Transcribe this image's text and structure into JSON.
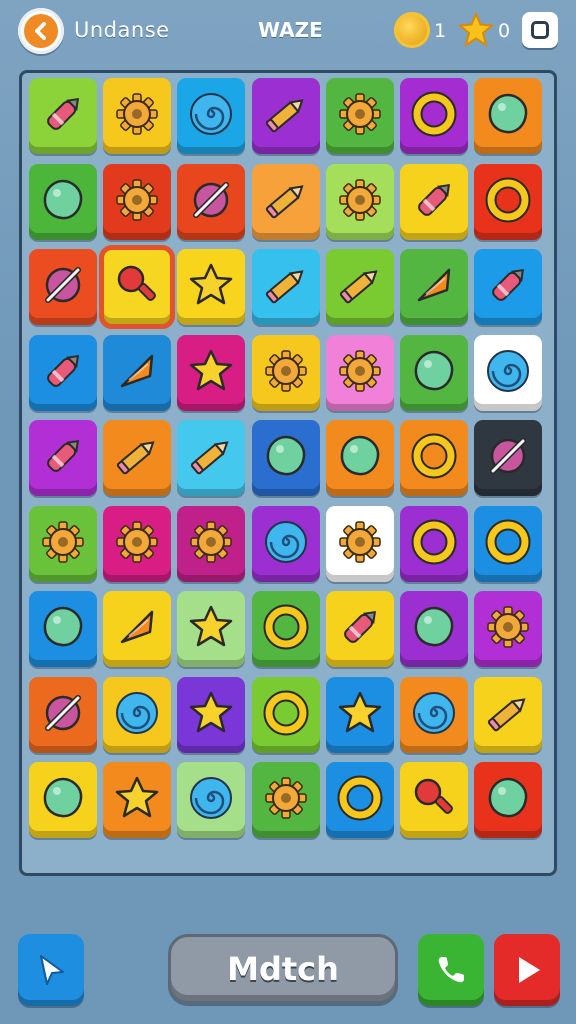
{
  "header": {
    "app_title": "Undanse",
    "level_title": "WAZE",
    "coins": "1",
    "stars": "0"
  },
  "board": {
    "rows": 9,
    "cols": 7,
    "selected": [
      2,
      1
    ],
    "tiles": [
      [
        {
          "color": "#8cd33a",
          "icon": "crayon-icon"
        },
        {
          "color": "#f6c71c",
          "icon": "gear-icon"
        },
        {
          "color": "#1ba6e8",
          "icon": "spiral-icon"
        },
        {
          "color": "#9b2fd1",
          "icon": "pencil-icon"
        },
        {
          "color": "#52b640",
          "icon": "gear-icon"
        },
        {
          "color": "#a52cd0",
          "icon": "ring-icon"
        },
        {
          "color": "#f28a1d",
          "icon": "blob-icon"
        }
      ],
      [
        {
          "color": "#4cb63a",
          "icon": "blob-icon"
        },
        {
          "color": "#e23a1d",
          "icon": "gear-icon"
        },
        {
          "color": "#e8461c",
          "icon": "crossed-icon"
        },
        {
          "color": "#f6a13a",
          "icon": "pencil-icon"
        },
        {
          "color": "#a5df5a",
          "icon": "gear-icon"
        },
        {
          "color": "#f6d21c",
          "icon": "crayon-icon"
        },
        {
          "color": "#e8321c",
          "icon": "ring-icon"
        }
      ],
      [
        {
          "color": "#ec4d20",
          "icon": "crossed-icon"
        },
        {
          "color": "#f6d620",
          "icon": "pin-icon"
        },
        {
          "color": "#f8d41c",
          "icon": "star-icon"
        },
        {
          "color": "#35c0ee",
          "icon": "pencil-icon"
        },
        {
          "color": "#7acb32",
          "icon": "pencil-icon"
        },
        {
          "color": "#52b640",
          "icon": "cone-icon"
        },
        {
          "color": "#1c9be8",
          "icon": "crayon-icon"
        }
      ],
      [
        {
          "color": "#1c8fe2",
          "icon": "crayon-icon"
        },
        {
          "color": "#1e8ad8",
          "icon": "cone-icon"
        },
        {
          "color": "#d81e84",
          "icon": "star-icon"
        },
        {
          "color": "#f6c71c",
          "icon": "gear-icon"
        },
        {
          "color": "#f080d8",
          "icon": "gear-icon"
        },
        {
          "color": "#52b640",
          "icon": "blob-icon"
        },
        {
          "color": "#ffffff",
          "icon": "spiral-icon"
        }
      ],
      [
        {
          "color": "#b22fd6",
          "icon": "crayon-icon"
        },
        {
          "color": "#f28a1d",
          "icon": "pencil-icon"
        },
        {
          "color": "#45c8ee",
          "icon": "pencil-icon"
        },
        {
          "color": "#2a6fcf",
          "icon": "blob-icon"
        },
        {
          "color": "#f28a1d",
          "icon": "blob-icon"
        },
        {
          "color": "#f28a1d",
          "icon": "ring-icon"
        },
        {
          "color": "#2f3740",
          "icon": "crossed-icon"
        }
      ],
      [
        {
          "color": "#6ac23a",
          "icon": "gear-icon"
        },
        {
          "color": "#d81e84",
          "icon": "gear-icon"
        },
        {
          "color": "#c0208a",
          "icon": "gear-icon"
        },
        {
          "color": "#9b2fd1",
          "icon": "spiral-icon"
        },
        {
          "color": "#ffffff",
          "icon": "gear-icon"
        },
        {
          "color": "#9b2fd1",
          "icon": "ring-icon"
        },
        {
          "color": "#1c8fe2",
          "icon": "ring-icon"
        }
      ],
      [
        {
          "color": "#1c8fe2",
          "icon": "blob-icon"
        },
        {
          "color": "#f6d21c",
          "icon": "cone-icon"
        },
        {
          "color": "#a5df8a",
          "icon": "star-icon"
        },
        {
          "color": "#52b640",
          "icon": "ring-icon"
        },
        {
          "color": "#f6d21c",
          "icon": "crayon-icon"
        },
        {
          "color": "#9b2fd1",
          "icon": "blob-icon"
        },
        {
          "color": "#b22fd6",
          "icon": "gear-icon"
        }
      ],
      [
        {
          "color": "#ec6a1d",
          "icon": "crossed-icon"
        },
        {
          "color": "#f6c71c",
          "icon": "spiral-icon"
        },
        {
          "color": "#7a36d6",
          "icon": "star-icon"
        },
        {
          "color": "#7acb32",
          "icon": "ring-icon"
        },
        {
          "color": "#1c8fe2",
          "icon": "star-icon"
        },
        {
          "color": "#f28a1d",
          "icon": "spiral-icon"
        },
        {
          "color": "#f6d21c",
          "icon": "pencil-icon"
        }
      ],
      [
        {
          "color": "#f6d21c",
          "icon": "blob-icon"
        },
        {
          "color": "#f28a1d",
          "icon": "star-icon"
        },
        {
          "color": "#a5df8a",
          "icon": "spiral-icon"
        },
        {
          "color": "#52b640",
          "icon": "gear-icon"
        },
        {
          "color": "#1c8fe2",
          "icon": "ring-icon"
        },
        {
          "color": "#f6d21c",
          "icon": "pin-icon"
        },
        {
          "color": "#e8321c",
          "icon": "blob-icon"
        }
      ]
    ]
  },
  "footer": {
    "match_label": "Mdtch"
  }
}
